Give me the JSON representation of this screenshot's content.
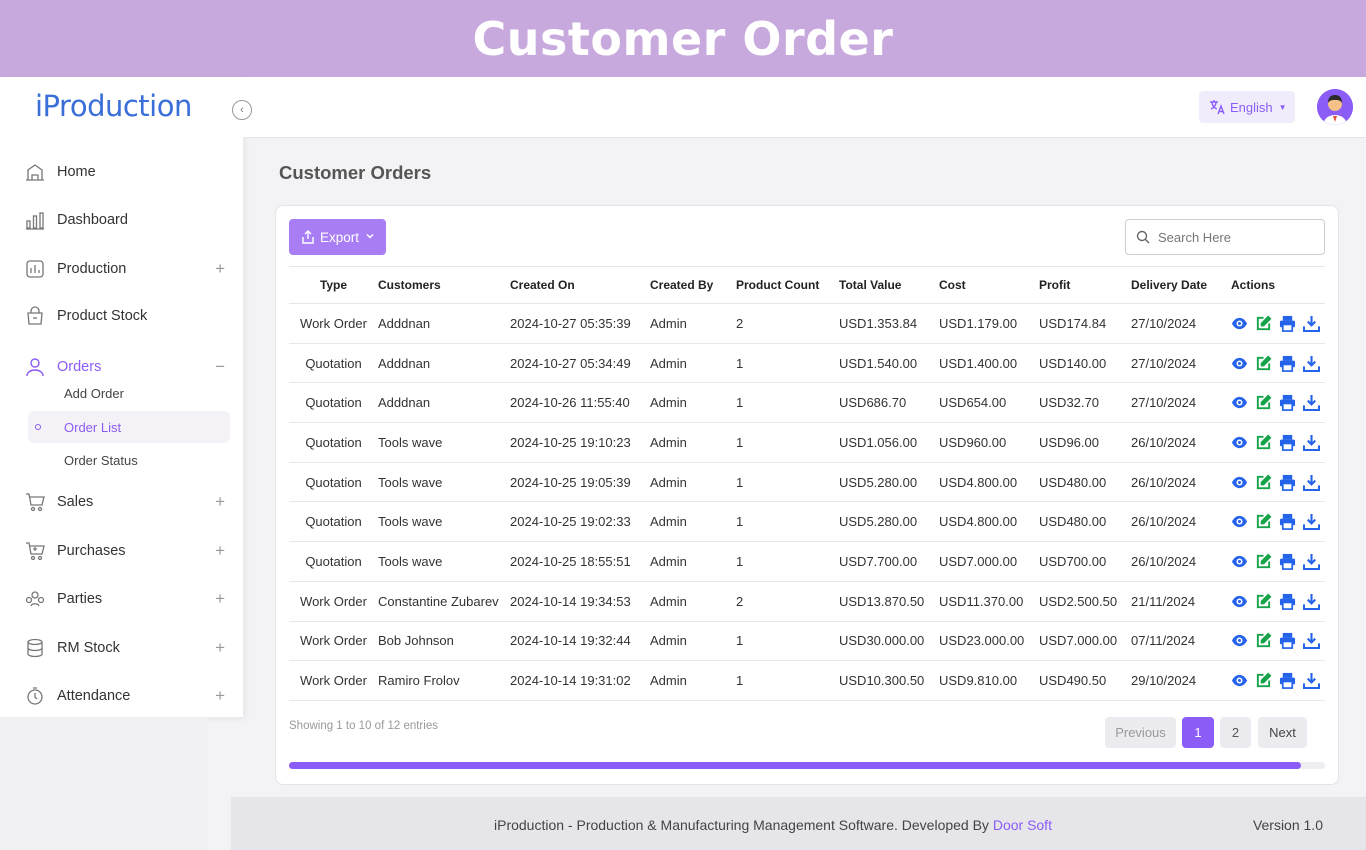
{
  "banner": {
    "title": "Customer Order"
  },
  "app": {
    "logo": "iProduction"
  },
  "sidebar": {
    "items": [
      {
        "label": "Home",
        "icon": "home-icon"
      },
      {
        "label": "Dashboard",
        "icon": "dashboard-icon"
      },
      {
        "label": "Production",
        "icon": "production-icon"
      },
      {
        "label": "Product Stock",
        "icon": "product-stock-icon"
      },
      {
        "label": "Orders",
        "icon": "orders-icon"
      },
      {
        "label": "Sales",
        "icon": "sales-icon"
      },
      {
        "label": "Purchases",
        "icon": "purchases-icon"
      },
      {
        "label": "Parties",
        "icon": "parties-icon"
      },
      {
        "label": "RM Stock",
        "icon": "rm-stock-icon"
      },
      {
        "label": "Attendance",
        "icon": "attendance-icon"
      }
    ],
    "orders_sub": [
      "Add Order",
      "Order List",
      "Order Status"
    ]
  },
  "topbar": {
    "language": "English"
  },
  "main": {
    "title": "Customer Orders",
    "export_label": "Export",
    "search_placeholder": "Search Here",
    "columns": [
      "Type",
      "Customers",
      "Created On",
      "Created By",
      "Product Count",
      "Total Value",
      "Cost",
      "Profit",
      "Delivery Date",
      "Actions"
    ],
    "rows": [
      [
        "Work Order",
        "Adddnan",
        "2024-10-27 05:35:39",
        "Admin",
        "2",
        "USD1.353.84",
        "USD1.179.00",
        "USD174.84",
        "27/10/2024"
      ],
      [
        "Quotation",
        "Adddnan",
        "2024-10-27 05:34:49",
        "Admin",
        "1",
        "USD1.540.00",
        "USD1.400.00",
        "USD140.00",
        "27/10/2024"
      ],
      [
        "Quotation",
        "Adddnan",
        "2024-10-26 11:55:40",
        "Admin",
        "1",
        "USD686.70",
        "USD654.00",
        "USD32.70",
        "27/10/2024"
      ],
      [
        "Quotation",
        "Tools wave",
        "2024-10-25 19:10:23",
        "Admin",
        "1",
        "USD1.056.00",
        "USD960.00",
        "USD96.00",
        "26/10/2024"
      ],
      [
        "Quotation",
        "Tools wave",
        "2024-10-25 19:05:39",
        "Admin",
        "1",
        "USD5.280.00",
        "USD4.800.00",
        "USD480.00",
        "26/10/2024"
      ],
      [
        "Quotation",
        "Tools wave",
        "2024-10-25 19:02:33",
        "Admin",
        "1",
        "USD5.280.00",
        "USD4.800.00",
        "USD480.00",
        "26/10/2024"
      ],
      [
        "Quotation",
        "Tools wave",
        "2024-10-25 18:55:51",
        "Admin",
        "1",
        "USD7.700.00",
        "USD7.000.00",
        "USD700.00",
        "26/10/2024"
      ],
      [
        "Work Order",
        "Constantine Zubarev",
        "2024-10-14 19:34:53",
        "Admin",
        "2",
        "USD13.870.50",
        "USD11.370.00",
        "USD2.500.50",
        "21/11/2024"
      ],
      [
        "Work Order",
        "Bob Johnson",
        "2024-10-14 19:32:44",
        "Admin",
        "1",
        "USD30.000.00",
        "USD23.000.00",
        "USD7.000.00",
        "07/11/2024"
      ],
      [
        "Work Order",
        "Ramiro Frolov",
        "2024-10-14 19:31:02",
        "Admin",
        "1",
        "USD10.300.50",
        "USD9.810.00",
        "USD490.50",
        "29/10/2024"
      ]
    ],
    "action_icons": [
      "view-icon",
      "edit-icon",
      "print-icon",
      "download-icon"
    ],
    "showing": "Showing 1 to 10 of 12 entries",
    "pagination": {
      "previous": "Previous",
      "pages": [
        "1",
        "2"
      ],
      "next": "Next",
      "current": "1"
    },
    "scroll_fraction": 0.977
  },
  "footer": {
    "text": "iProduction - Production & Manufacturing Management Software. Developed By ",
    "link": "Door Soft",
    "version": "Version 1.0"
  },
  "colors": {
    "accent": "#8b5cf6",
    "banner": "#c8a9dd",
    "action_blue": "#2563eb",
    "action_green": "#16a34a"
  }
}
